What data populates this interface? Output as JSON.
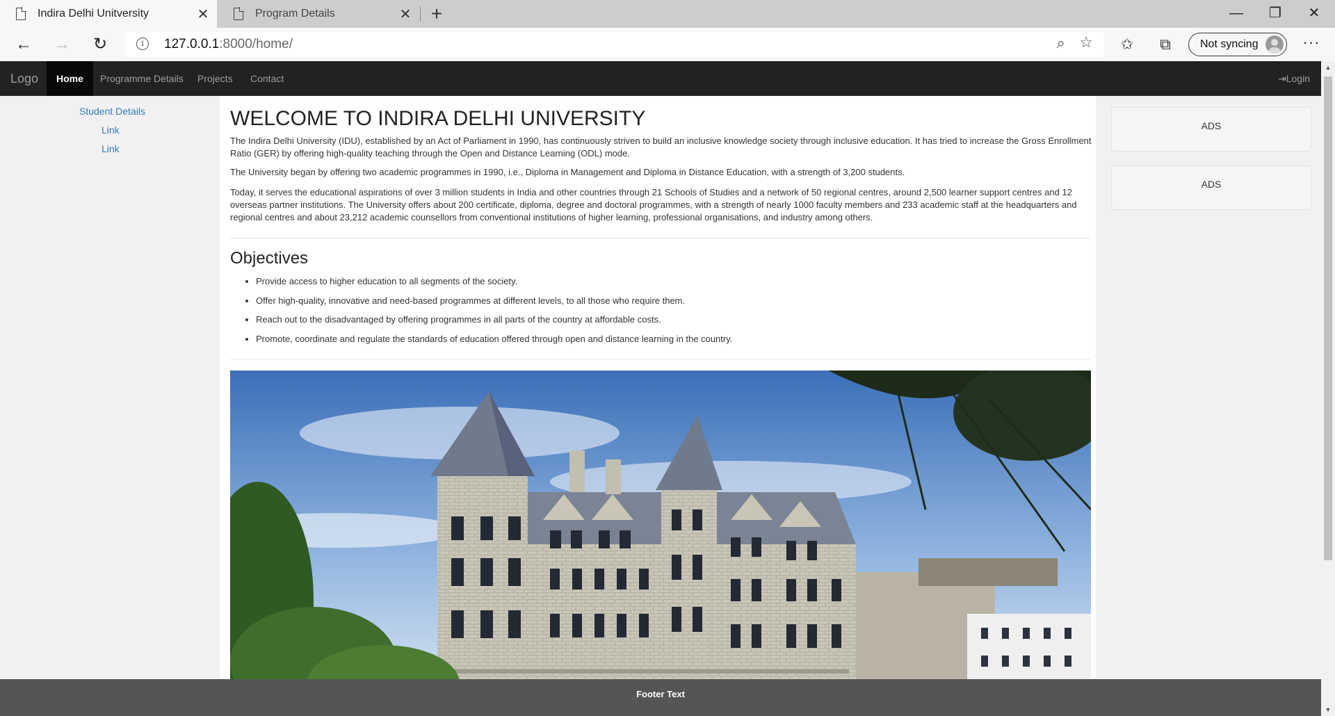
{
  "browser": {
    "tabs": [
      {
        "title": "Indira Delhi Unitversity",
        "active": true
      },
      {
        "title": "Program Details",
        "active": false
      }
    ],
    "url_host": "127.0.0.1",
    "url_path": ":8000/home/",
    "sync_label": "Not syncing"
  },
  "site": {
    "brand": "Logo",
    "nav": [
      "Home",
      "Programme Details",
      "Projects",
      "Contact"
    ],
    "login": "Login",
    "sidebar_links": [
      "Student Details",
      "Link",
      "Link"
    ],
    "ads": [
      "ADS",
      "ADS"
    ],
    "footer": "Footer Text"
  },
  "main": {
    "title": "WELCOME TO INDIRA DELHI UNIVERSITY",
    "paragraphs": [
      "The Indira Delhi University (IDU), established by an Act of Parliament in 1990, has continuously striven to build an inclusive knowledge society through inclusive education. It has tried to increase the Gross Enrollment Ratio (GER) by offering high-quality teaching through the Open and Distance Learning (ODL) mode.",
      "The University began by offering two academic programmes in 1990, i.e., Diploma in Management and Diploma in Distance Education, with a strength of 3,200 students.",
      "Today, it serves the educational aspirations of over 3 million students in India and other countries through 21 Schools of Studies and a network of 50 regional centres, around 2,500 learner support centres and 12 overseas partner institutions. The University offers about 200 certificate, diploma, degree and doctoral programmes, with a strength of nearly 1000 faculty members and 233 academic staff at the headquarters and regional centres and about 23,212 academic counsellors from conventional institutions of higher learning, professional organisations, and industry among others."
    ],
    "objectives_title": "Objectives",
    "objectives": [
      "Provide access to higher education to all segments of the society.",
      "Offer high-quality, innovative and need-based programmes at different levels, to all those who require them.",
      "Reach out to the disadvantaged by offering programmes in all parts of the country at affordable costs.",
      "Promote, coordinate and regulate the standards of education offered through open and distance learning in the country."
    ]
  }
}
